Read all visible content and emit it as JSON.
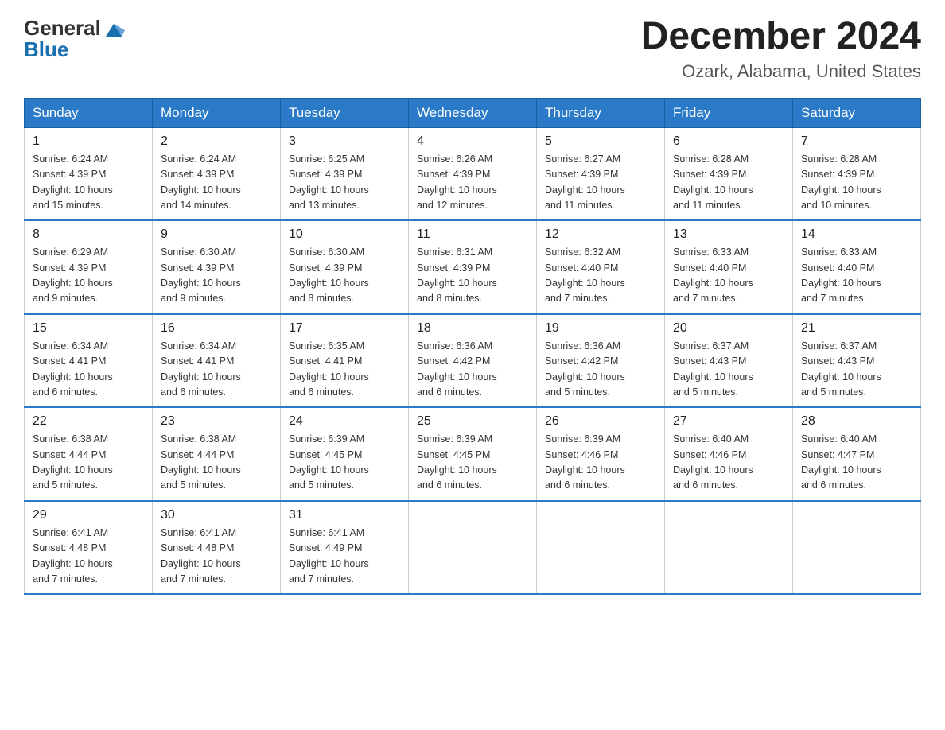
{
  "logo": {
    "text_general": "General",
    "text_blue": "Blue"
  },
  "title": "December 2024",
  "subtitle": "Ozark, Alabama, United States",
  "days_of_week": [
    "Sunday",
    "Monday",
    "Tuesday",
    "Wednesday",
    "Thursday",
    "Friday",
    "Saturday"
  ],
  "weeks": [
    [
      {
        "day": "1",
        "sunrise": "6:24 AM",
        "sunset": "4:39 PM",
        "daylight": "10 hours and 15 minutes."
      },
      {
        "day": "2",
        "sunrise": "6:24 AM",
        "sunset": "4:39 PM",
        "daylight": "10 hours and 14 minutes."
      },
      {
        "day": "3",
        "sunrise": "6:25 AM",
        "sunset": "4:39 PM",
        "daylight": "10 hours and 13 minutes."
      },
      {
        "day": "4",
        "sunrise": "6:26 AM",
        "sunset": "4:39 PM",
        "daylight": "10 hours and 12 minutes."
      },
      {
        "day": "5",
        "sunrise": "6:27 AM",
        "sunset": "4:39 PM",
        "daylight": "10 hours and 11 minutes."
      },
      {
        "day": "6",
        "sunrise": "6:28 AM",
        "sunset": "4:39 PM",
        "daylight": "10 hours and 11 minutes."
      },
      {
        "day": "7",
        "sunrise": "6:28 AM",
        "sunset": "4:39 PM",
        "daylight": "10 hours and 10 minutes."
      }
    ],
    [
      {
        "day": "8",
        "sunrise": "6:29 AM",
        "sunset": "4:39 PM",
        "daylight": "10 hours and 9 minutes."
      },
      {
        "day": "9",
        "sunrise": "6:30 AM",
        "sunset": "4:39 PM",
        "daylight": "10 hours and 9 minutes."
      },
      {
        "day": "10",
        "sunrise": "6:30 AM",
        "sunset": "4:39 PM",
        "daylight": "10 hours and 8 minutes."
      },
      {
        "day": "11",
        "sunrise": "6:31 AM",
        "sunset": "4:39 PM",
        "daylight": "10 hours and 8 minutes."
      },
      {
        "day": "12",
        "sunrise": "6:32 AM",
        "sunset": "4:40 PM",
        "daylight": "10 hours and 7 minutes."
      },
      {
        "day": "13",
        "sunrise": "6:33 AM",
        "sunset": "4:40 PM",
        "daylight": "10 hours and 7 minutes."
      },
      {
        "day": "14",
        "sunrise": "6:33 AM",
        "sunset": "4:40 PM",
        "daylight": "10 hours and 7 minutes."
      }
    ],
    [
      {
        "day": "15",
        "sunrise": "6:34 AM",
        "sunset": "4:41 PM",
        "daylight": "10 hours and 6 minutes."
      },
      {
        "day": "16",
        "sunrise": "6:34 AM",
        "sunset": "4:41 PM",
        "daylight": "10 hours and 6 minutes."
      },
      {
        "day": "17",
        "sunrise": "6:35 AM",
        "sunset": "4:41 PM",
        "daylight": "10 hours and 6 minutes."
      },
      {
        "day": "18",
        "sunrise": "6:36 AM",
        "sunset": "4:42 PM",
        "daylight": "10 hours and 6 minutes."
      },
      {
        "day": "19",
        "sunrise": "6:36 AM",
        "sunset": "4:42 PM",
        "daylight": "10 hours and 5 minutes."
      },
      {
        "day": "20",
        "sunrise": "6:37 AM",
        "sunset": "4:43 PM",
        "daylight": "10 hours and 5 minutes."
      },
      {
        "day": "21",
        "sunrise": "6:37 AM",
        "sunset": "4:43 PM",
        "daylight": "10 hours and 5 minutes."
      }
    ],
    [
      {
        "day": "22",
        "sunrise": "6:38 AM",
        "sunset": "4:44 PM",
        "daylight": "10 hours and 5 minutes."
      },
      {
        "day": "23",
        "sunrise": "6:38 AM",
        "sunset": "4:44 PM",
        "daylight": "10 hours and 5 minutes."
      },
      {
        "day": "24",
        "sunrise": "6:39 AM",
        "sunset": "4:45 PM",
        "daylight": "10 hours and 5 minutes."
      },
      {
        "day": "25",
        "sunrise": "6:39 AM",
        "sunset": "4:45 PM",
        "daylight": "10 hours and 6 minutes."
      },
      {
        "day": "26",
        "sunrise": "6:39 AM",
        "sunset": "4:46 PM",
        "daylight": "10 hours and 6 minutes."
      },
      {
        "day": "27",
        "sunrise": "6:40 AM",
        "sunset": "4:46 PM",
        "daylight": "10 hours and 6 minutes."
      },
      {
        "day": "28",
        "sunrise": "6:40 AM",
        "sunset": "4:47 PM",
        "daylight": "10 hours and 6 minutes."
      }
    ],
    [
      {
        "day": "29",
        "sunrise": "6:41 AM",
        "sunset": "4:48 PM",
        "daylight": "10 hours and 7 minutes."
      },
      {
        "day": "30",
        "sunrise": "6:41 AM",
        "sunset": "4:48 PM",
        "daylight": "10 hours and 7 minutes."
      },
      {
        "day": "31",
        "sunrise": "6:41 AM",
        "sunset": "4:49 PM",
        "daylight": "10 hours and 7 minutes."
      },
      null,
      null,
      null,
      null
    ]
  ],
  "labels": {
    "sunrise": "Sunrise:",
    "sunset": "Sunset:",
    "daylight": "Daylight:"
  }
}
